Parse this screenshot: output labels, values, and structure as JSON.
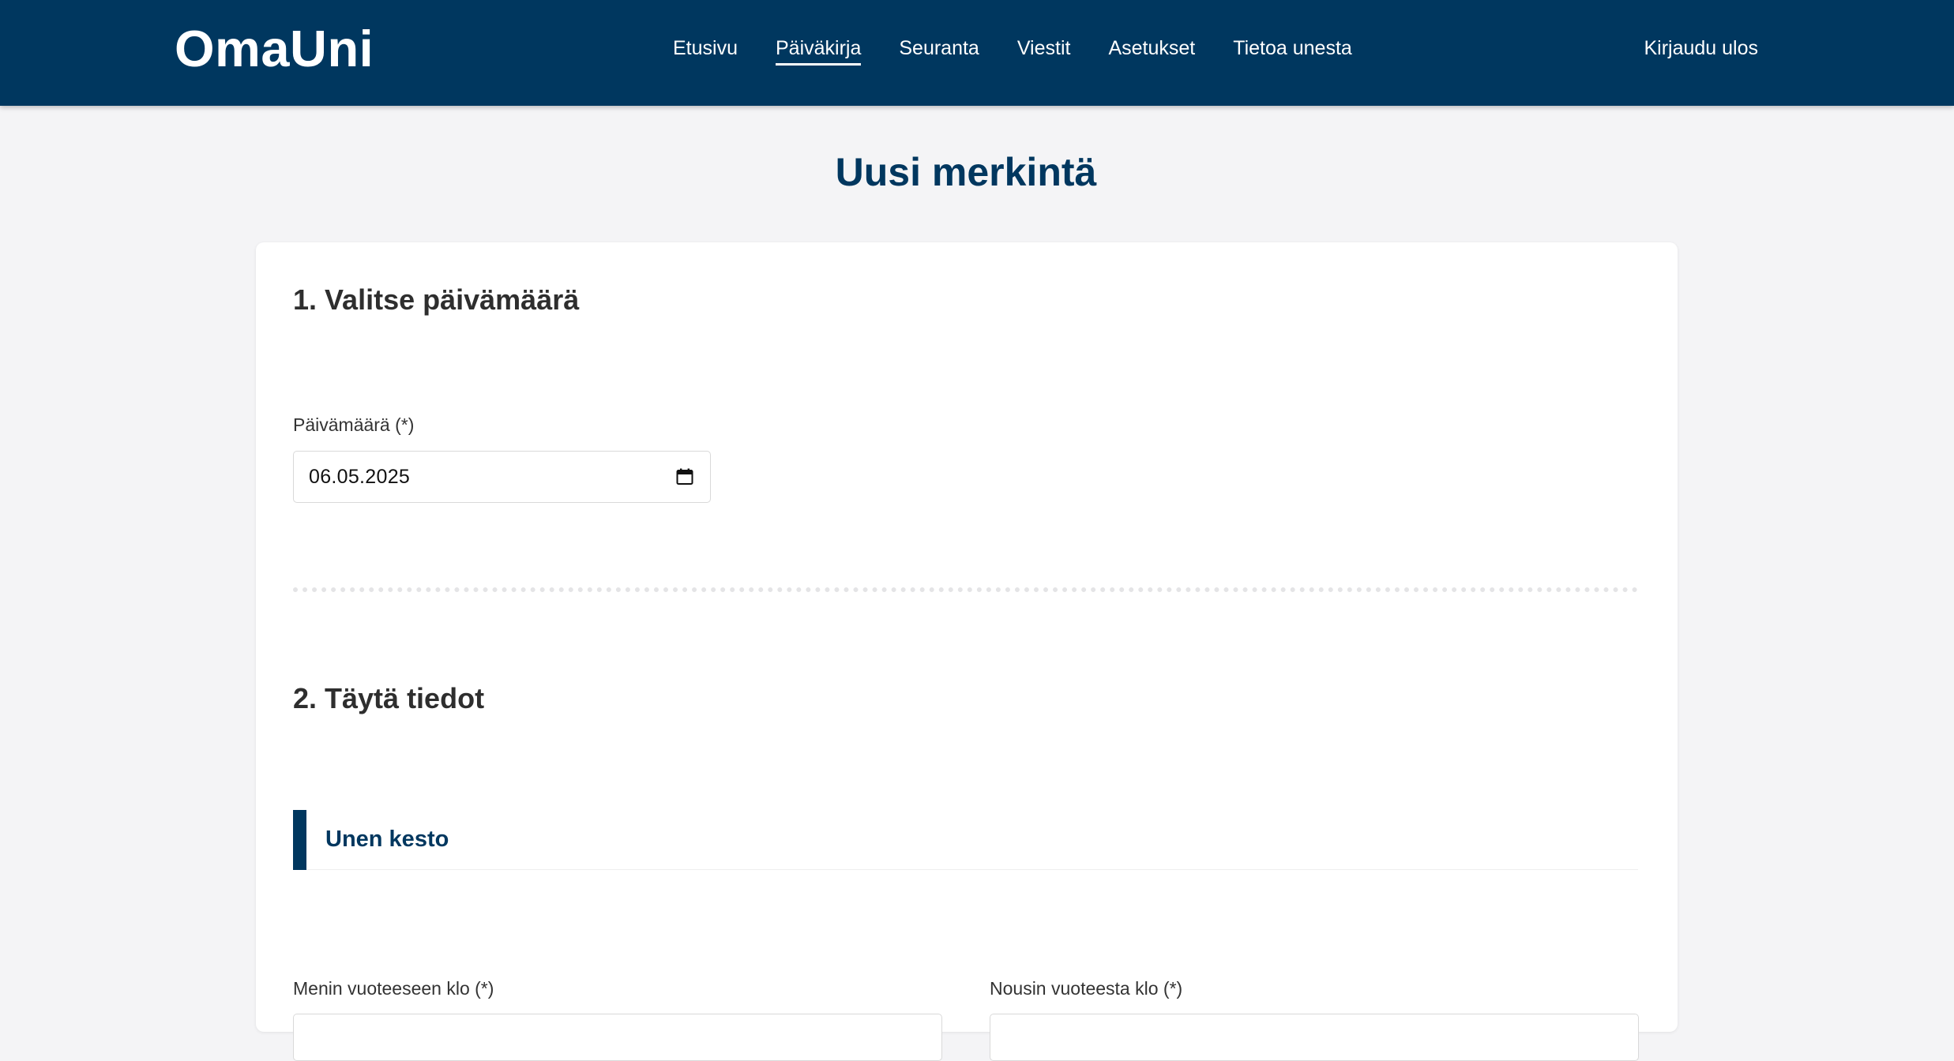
{
  "header": {
    "brand": "OmaUni",
    "nav": [
      {
        "label": "Etusivu",
        "active": false
      },
      {
        "label": "Päiväkirja",
        "active": true
      },
      {
        "label": "Seuranta",
        "active": false
      },
      {
        "label": "Viestit",
        "active": false
      },
      {
        "label": "Asetukset",
        "active": false
      },
      {
        "label": "Tietoa unesta",
        "active": false
      }
    ],
    "logout_label": "Kirjaudu ulos"
  },
  "page": {
    "title": "Uusi merkintä"
  },
  "form": {
    "section1": {
      "heading": "1. Valitse päivämäärä",
      "date_label": "Päivämäärä (*)",
      "date_value": "06.05.2025",
      "date_icon": "calendar-icon"
    },
    "section2": {
      "heading": "2. Täytä tiedot",
      "subsection_title": "Unen kesto",
      "bedtime_label": "Menin vuoteeseen klo (*)",
      "wakeup_label": "Nousin vuoteesta klo (*)"
    }
  },
  "colors": {
    "primary": "#00375f",
    "background": "#f4f4f6",
    "card": "#ffffff"
  }
}
